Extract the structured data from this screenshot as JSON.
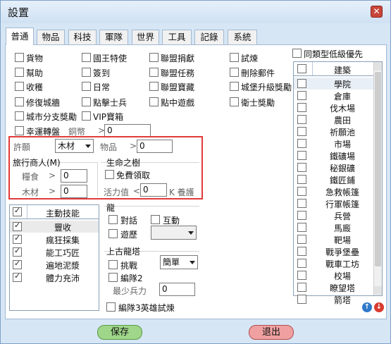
{
  "window": {
    "title": "設置",
    "close": "✕"
  },
  "tabs": [
    "普通",
    "物品",
    "科技",
    "軍隊",
    "世界",
    "工具",
    "記錄",
    "系統"
  ],
  "checks": [
    {
      "label": "貨物",
      "on": false
    },
    {
      "label": "國王特使",
      "on": false
    },
    {
      "label": "聯盟捐獻",
      "on": false
    },
    {
      "label": "試煉",
      "on": false
    },
    {
      "label": "幫助",
      "on": false
    },
    {
      "label": "簽到",
      "on": false
    },
    {
      "label": "聯盟任務",
      "on": false
    },
    {
      "label": "刪除郵件",
      "on": false
    },
    {
      "label": "收穫",
      "on": false
    },
    {
      "label": "日常",
      "on": false
    },
    {
      "label": "聯盟寶藏",
      "on": false
    },
    {
      "label": "城堡升級獎勵",
      "on": false
    },
    {
      "label": "修復城牆",
      "on": false
    },
    {
      "label": "點擊士兵",
      "on": false
    },
    {
      "label": "點中遊戲",
      "on": false
    },
    {
      "label": "衛士獎勵",
      "on": false
    },
    {
      "label": "城市分支獎勵",
      "on": false
    },
    {
      "label": "VIP寶箱",
      "on": false
    }
  ],
  "lucky": {
    "label": "幸運轉盤",
    "unit": "銅幣",
    "op": ">",
    "value": "0"
  },
  "tribute": {
    "label": "許願",
    "select": "木材",
    "item_label": "物品",
    "op": ">",
    "value": "0"
  },
  "merchant": {
    "title": "旅行商人(M)",
    "food_label": "糧食",
    "food_op": ">",
    "food_value": "0",
    "wood_label": "木材",
    "wood_op": ">",
    "wood_value": "0"
  },
  "tree": {
    "title": "生命之樹",
    "free_label": "免費領取",
    "vitality_label": "活力值",
    "op": "<",
    "value": "0",
    "suffix": "K 養護"
  },
  "skills": {
    "header": "主動技能",
    "items": [
      "豐收",
      "瘋狂採集",
      "能工巧匠",
      "遍地泥漿",
      "體力充沛"
    ]
  },
  "dragon": {
    "title": "龍",
    "dialog": "對話",
    "interact": "互動",
    "travel": "遊歷"
  },
  "ancient": {
    "title": "上古龍塔",
    "challenge": "挑戰",
    "mode": "簡單",
    "squad2": "編隊2",
    "min_label": "最少兵力",
    "min_value": "0"
  },
  "squad3": "編隊3英雄試煉",
  "low_priority": "同類型低級優先",
  "buildings": {
    "header": "建築",
    "items": [
      "學院",
      "倉庫",
      "伐木場",
      "農田",
      "祈願池",
      "市場",
      "鐵礦場",
      "秘銀礦",
      "鐵匠鋪",
      "急救帳篷",
      "行軍帳篷",
      "兵營",
      "馬廄",
      "靶場",
      "戰爭堡壘",
      "戰車工坊",
      "校場",
      "瞭望塔",
      "箭塔"
    ]
  },
  "buttons": {
    "save": "保存",
    "exit": "退出"
  },
  "colors": {
    "highlight": "#e23a3a",
    "save": "#9fd68a",
    "exit": "#f0a0a0"
  }
}
